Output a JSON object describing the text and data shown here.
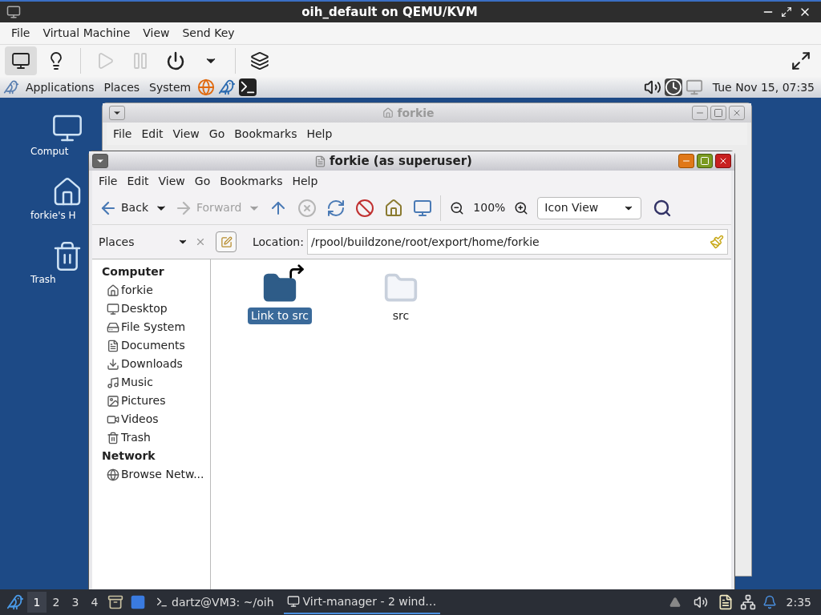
{
  "vm_window": {
    "title": "oih_default on QEMU/KVM"
  },
  "vm_menu": [
    "File",
    "Virtual Machine",
    "View",
    "Send Key"
  ],
  "vm_toolbar": [
    {
      "kind": "console",
      "selected": true,
      "disabled": false
    },
    {
      "kind": "details",
      "selected": false,
      "disabled": false
    },
    {
      "kind": "separator"
    },
    {
      "kind": "run",
      "selected": false,
      "disabled": true
    },
    {
      "kind": "pause",
      "selected": false,
      "disabled": true
    },
    {
      "kind": "power",
      "selected": false,
      "disabled": false
    },
    {
      "kind": "power-menu",
      "selected": false,
      "disabled": false
    },
    {
      "kind": "separator"
    },
    {
      "kind": "snapshots",
      "selected": false,
      "disabled": false
    }
  ],
  "guest_panel": {
    "menus": [
      "Applications",
      "Places",
      "System"
    ],
    "clock": "Tue Nov 15, 07:35"
  },
  "desktop_icons": [
    {
      "kind": "computer",
      "label": "Comput"
    },
    {
      "kind": "home",
      "label": "forkie's H"
    },
    {
      "kind": "trash",
      "label": "Trash"
    }
  ],
  "back_window": {
    "title": "forkie",
    "menu": [
      "File",
      "Edit",
      "View",
      "Go",
      "Bookmarks",
      "Help"
    ]
  },
  "front_window": {
    "title": "forkie (as superuser)",
    "menu": [
      "File",
      "Edit",
      "View",
      "Go",
      "Bookmarks",
      "Help"
    ],
    "toolbar": [
      {
        "kind": "back",
        "label": "Back",
        "disabled": false
      },
      {
        "kind": "forward",
        "label": "Forward",
        "disabled": true
      },
      {
        "kind": "up",
        "disabled": false
      },
      {
        "kind": "stop",
        "disabled": true
      },
      {
        "kind": "reload",
        "disabled": false
      },
      {
        "kind": "restricted",
        "disabled": false
      },
      {
        "kind": "home",
        "disabled": false
      },
      {
        "kind": "computer",
        "disabled": false
      }
    ],
    "zoom": "100%",
    "view_mode": "Icon View",
    "sidebar_mode": "Places",
    "location_label": "Location:",
    "location": "/rpool/buildzone/root/export/home/forkie",
    "sidebar": [
      {
        "heading": "Computer",
        "items": [
          {
            "kind": "home",
            "label": "forkie"
          },
          {
            "kind": "desktop",
            "label": "Desktop"
          },
          {
            "kind": "drive",
            "label": "File System"
          },
          {
            "kind": "documents",
            "label": "Documents"
          },
          {
            "kind": "downloads",
            "label": "Downloads"
          },
          {
            "kind": "music",
            "label": "Music"
          },
          {
            "kind": "pictures",
            "label": "Pictures"
          },
          {
            "kind": "videos",
            "label": "Videos"
          },
          {
            "kind": "trash",
            "label": "Trash"
          }
        ]
      },
      {
        "heading": "Network",
        "items": [
          {
            "kind": "network",
            "label": "Browse Netw..."
          }
        ]
      }
    ],
    "files": [
      {
        "kind": "link",
        "name": "Link to src",
        "selected": true
      },
      {
        "kind": "folder",
        "name": "src",
        "selected": false
      }
    ]
  },
  "taskbar": {
    "workspaces": [
      {
        "label": "1",
        "selected": true
      },
      {
        "label": "2",
        "selected": false
      },
      {
        "label": "3",
        "selected": false
      },
      {
        "label": "4",
        "selected": false
      }
    ],
    "tasks": [
      {
        "kind": "terminal",
        "label": "dartz@VM3: ~/oih",
        "selected": false
      },
      {
        "kind": "virt",
        "label": "Virt-manager - 2 wind…",
        "selected": true
      }
    ],
    "clock": "2:35"
  }
}
